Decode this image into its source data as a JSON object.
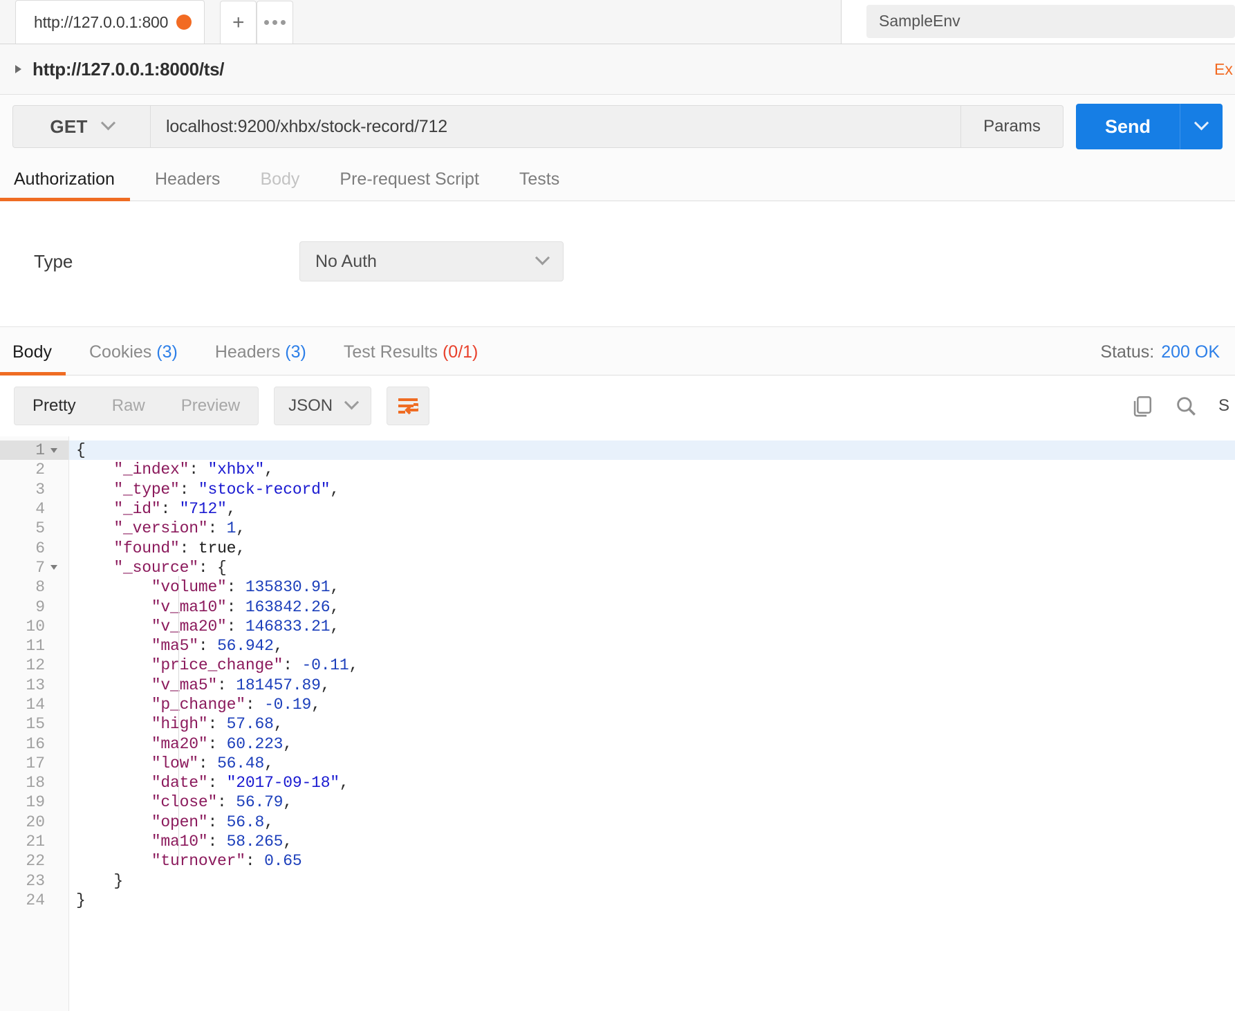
{
  "tabstrip": {
    "request_tab_label": "http://127.0.0.1:800",
    "new_tab_label": "+",
    "environment_name": "SampleEnv"
  },
  "breadcrumb": {
    "path": "http://127.0.0.1:8000/ts/",
    "examples_label": "Ex"
  },
  "request": {
    "method": "GET",
    "url": "localhost:9200/xhbx/stock-record/712",
    "params_label": "Params",
    "send_label": "Send"
  },
  "request_tabs": [
    {
      "label": "Authorization",
      "state": "active"
    },
    {
      "label": "Headers",
      "state": "normal"
    },
    {
      "label": "Body",
      "state": "muted"
    },
    {
      "label": "Pre-request Script",
      "state": "normal"
    },
    {
      "label": "Tests",
      "state": "normal"
    }
  ],
  "auth": {
    "type_label": "Type",
    "selected": "No Auth"
  },
  "response_tabs": [
    {
      "label": "Body",
      "count": "",
      "state": "active"
    },
    {
      "label": "Cookies",
      "count": "(3)",
      "count_color": "blue",
      "state": "normal"
    },
    {
      "label": "Headers",
      "count": "(3)",
      "count_color": "blue",
      "state": "normal"
    },
    {
      "label": "Test Results",
      "count": "(0/1)",
      "count_color": "red",
      "state": "normal"
    }
  ],
  "status": {
    "label": "Status:",
    "value": "200 OK"
  },
  "body_toolbar": {
    "pretty": "Pretty",
    "raw": "Raw",
    "preview": "Preview",
    "format": "JSON",
    "wrap_icon": "word-wrap-icon",
    "copy_icon": "copy-icon",
    "search_icon": "search-icon",
    "save_label": "S"
  },
  "colors": {
    "accent_orange": "#ef6c23",
    "send_blue": "#167ee5",
    "status_blue": "#2d7fe8",
    "error_red": "#e8412c",
    "json_key": "#8b1a5c",
    "json_string": "#1a1ad1",
    "json_number": "#1c3fbb"
  },
  "response_body": {
    "line_count": 24,
    "lines": [
      {
        "num": "1",
        "fold": true,
        "indent": 0,
        "tokens": [
          {
            "t": "{",
            "c": "p"
          }
        ]
      },
      {
        "num": "2",
        "fold": false,
        "indent": 1,
        "tokens": [
          {
            "t": "\"_index\"",
            "c": "k"
          },
          {
            "t": ": ",
            "c": "p"
          },
          {
            "t": "\"xhbx\"",
            "c": "s"
          },
          {
            "t": ",",
            "c": "p"
          }
        ]
      },
      {
        "num": "3",
        "fold": false,
        "indent": 1,
        "tokens": [
          {
            "t": "\"_type\"",
            "c": "k"
          },
          {
            "t": ": ",
            "c": "p"
          },
          {
            "t": "\"stock-record\"",
            "c": "s"
          },
          {
            "t": ",",
            "c": "p"
          }
        ]
      },
      {
        "num": "4",
        "fold": false,
        "indent": 1,
        "tokens": [
          {
            "t": "\"_id\"",
            "c": "k"
          },
          {
            "t": ": ",
            "c": "p"
          },
          {
            "t": "\"712\"",
            "c": "s"
          },
          {
            "t": ",",
            "c": "p"
          }
        ]
      },
      {
        "num": "5",
        "fold": false,
        "indent": 1,
        "tokens": [
          {
            "t": "\"_version\"",
            "c": "k"
          },
          {
            "t": ": ",
            "c": "p"
          },
          {
            "t": "1",
            "c": "n"
          },
          {
            "t": ",",
            "c": "p"
          }
        ]
      },
      {
        "num": "6",
        "fold": false,
        "indent": 1,
        "tokens": [
          {
            "t": "\"found\"",
            "c": "k"
          },
          {
            "t": ": ",
            "c": "p"
          },
          {
            "t": "true",
            "c": "b"
          },
          {
            "t": ",",
            "c": "p"
          }
        ]
      },
      {
        "num": "7",
        "fold": true,
        "indent": 1,
        "tokens": [
          {
            "t": "\"_source\"",
            "c": "k"
          },
          {
            "t": ": {",
            "c": "p"
          }
        ]
      },
      {
        "num": "8",
        "fold": false,
        "indent": 2,
        "tokens": [
          {
            "t": "\"volume\"",
            "c": "k"
          },
          {
            "t": ": ",
            "c": "p"
          },
          {
            "t": "135830.91",
            "c": "n"
          },
          {
            "t": ",",
            "c": "p"
          }
        ]
      },
      {
        "num": "9",
        "fold": false,
        "indent": 2,
        "tokens": [
          {
            "t": "\"v_ma10\"",
            "c": "k"
          },
          {
            "t": ": ",
            "c": "p"
          },
          {
            "t": "163842.26",
            "c": "n"
          },
          {
            "t": ",",
            "c": "p"
          }
        ]
      },
      {
        "num": "10",
        "fold": false,
        "indent": 2,
        "tokens": [
          {
            "t": "\"v_ma20\"",
            "c": "k"
          },
          {
            "t": ": ",
            "c": "p"
          },
          {
            "t": "146833.21",
            "c": "n"
          },
          {
            "t": ",",
            "c": "p"
          }
        ]
      },
      {
        "num": "11",
        "fold": false,
        "indent": 2,
        "tokens": [
          {
            "t": "\"ma5\"",
            "c": "k"
          },
          {
            "t": ": ",
            "c": "p"
          },
          {
            "t": "56.942",
            "c": "n"
          },
          {
            "t": ",",
            "c": "p"
          }
        ]
      },
      {
        "num": "12",
        "fold": false,
        "indent": 2,
        "tokens": [
          {
            "t": "\"price_change\"",
            "c": "k"
          },
          {
            "t": ": ",
            "c": "p"
          },
          {
            "t": "-0.11",
            "c": "n"
          },
          {
            "t": ",",
            "c": "p"
          }
        ]
      },
      {
        "num": "13",
        "fold": false,
        "indent": 2,
        "tokens": [
          {
            "t": "\"v_ma5\"",
            "c": "k"
          },
          {
            "t": ": ",
            "c": "p"
          },
          {
            "t": "181457.89",
            "c": "n"
          },
          {
            "t": ",",
            "c": "p"
          }
        ]
      },
      {
        "num": "14",
        "fold": false,
        "indent": 2,
        "tokens": [
          {
            "t": "\"p_change\"",
            "c": "k"
          },
          {
            "t": ": ",
            "c": "p"
          },
          {
            "t": "-0.19",
            "c": "n"
          },
          {
            "t": ",",
            "c": "p"
          }
        ]
      },
      {
        "num": "15",
        "fold": false,
        "indent": 2,
        "tokens": [
          {
            "t": "\"high\"",
            "c": "k"
          },
          {
            "t": ": ",
            "c": "p"
          },
          {
            "t": "57.68",
            "c": "n"
          },
          {
            "t": ",",
            "c": "p"
          }
        ]
      },
      {
        "num": "16",
        "fold": false,
        "indent": 2,
        "tokens": [
          {
            "t": "\"ma20\"",
            "c": "k"
          },
          {
            "t": ": ",
            "c": "p"
          },
          {
            "t": "60.223",
            "c": "n"
          },
          {
            "t": ",",
            "c": "p"
          }
        ]
      },
      {
        "num": "17",
        "fold": false,
        "indent": 2,
        "tokens": [
          {
            "t": "\"low\"",
            "c": "k"
          },
          {
            "t": ": ",
            "c": "p"
          },
          {
            "t": "56.48",
            "c": "n"
          },
          {
            "t": ",",
            "c": "p"
          }
        ]
      },
      {
        "num": "18",
        "fold": false,
        "indent": 2,
        "tokens": [
          {
            "t": "\"date\"",
            "c": "k"
          },
          {
            "t": ": ",
            "c": "p"
          },
          {
            "t": "\"2017-09-18\"",
            "c": "s"
          },
          {
            "t": ",",
            "c": "p"
          }
        ]
      },
      {
        "num": "19",
        "fold": false,
        "indent": 2,
        "tokens": [
          {
            "t": "\"close\"",
            "c": "k"
          },
          {
            "t": ": ",
            "c": "p"
          },
          {
            "t": "56.79",
            "c": "n"
          },
          {
            "t": ",",
            "c": "p"
          }
        ]
      },
      {
        "num": "20",
        "fold": false,
        "indent": 2,
        "tokens": [
          {
            "t": "\"open\"",
            "c": "k"
          },
          {
            "t": ": ",
            "c": "p"
          },
          {
            "t": "56.8",
            "c": "n"
          },
          {
            "t": ",",
            "c": "p"
          }
        ]
      },
      {
        "num": "21",
        "fold": false,
        "indent": 2,
        "tokens": [
          {
            "t": "\"ma10\"",
            "c": "k"
          },
          {
            "t": ": ",
            "c": "p"
          },
          {
            "t": "58.265",
            "c": "n"
          },
          {
            "t": ",",
            "c": "p"
          }
        ]
      },
      {
        "num": "22",
        "fold": false,
        "indent": 2,
        "tokens": [
          {
            "t": "\"turnover\"",
            "c": "k"
          },
          {
            "t": ": ",
            "c": "p"
          },
          {
            "t": "0.65",
            "c": "n"
          }
        ]
      },
      {
        "num": "23",
        "fold": false,
        "indent": 1,
        "tokens": [
          {
            "t": "}",
            "c": "p"
          }
        ]
      },
      {
        "num": "24",
        "fold": false,
        "indent": 0,
        "tokens": [
          {
            "t": "}",
            "c": "p"
          }
        ]
      }
    ],
    "parsed": {
      "_index": "xhbx",
      "_type": "stock-record",
      "_id": "712",
      "_version": 1,
      "found": true,
      "_source": {
        "volume": 135830.91,
        "v_ma10": 163842.26,
        "v_ma20": 146833.21,
        "ma5": 56.942,
        "price_change": -0.11,
        "v_ma5": 181457.89,
        "p_change": -0.19,
        "high": 57.68,
        "ma20": 60.223,
        "low": 56.48,
        "date": "2017-09-18",
        "close": 56.79,
        "open": 56.8,
        "ma10": 58.265,
        "turnover": 0.65
      }
    }
  }
}
